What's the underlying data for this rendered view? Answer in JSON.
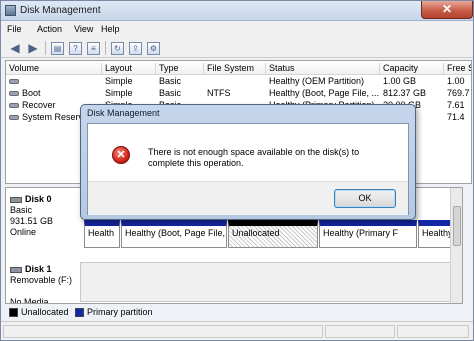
{
  "window": {
    "title": "Disk Management",
    "close_glyph": "✕"
  },
  "menu": [
    "File",
    "Action",
    "View",
    "Help"
  ],
  "toolbar": {
    "icons": [
      "back-arrow-icon",
      "forward-arrow-icon",
      "console-tree-icon",
      "help-icon",
      "properties-icon",
      "refresh-icon",
      "export-icon"
    ]
  },
  "volumes": {
    "columns": [
      "Volume",
      "Layout",
      "Type",
      "File System",
      "Status",
      "Capacity",
      "Free S"
    ],
    "rows": [
      {
        "volume": "",
        "layout": "Simple",
        "type": "Basic",
        "fs": "",
        "status": "Healthy (OEM Partition)",
        "capacity": "1.00 GB",
        "free": "1.00"
      },
      {
        "volume": "Boot",
        "layout": "Simple",
        "type": "Basic",
        "fs": "NTFS",
        "status": "Healthy (Boot, Page File, ...",
        "capacity": "812.37 GB",
        "free": "769.7"
      },
      {
        "volume": "Recover",
        "layout": "Simple",
        "type": "Basic",
        "fs": "",
        "status": "Healthy (Primary Partition)",
        "capacity": "20.00 GB",
        "free": "7.61"
      },
      {
        "volume": "System Reserved",
        "layout": "",
        "type": "",
        "fs": "",
        "status": "",
        "capacity": "",
        "free": "71.4"
      }
    ]
  },
  "disks": [
    {
      "name": "Disk 0",
      "type": "Basic",
      "size": "931.51 GB",
      "state": "Online",
      "partitions": [
        "Health",
        "Healthy (Boot, Page File, C",
        "Unallocated",
        "Healthy (Primary F",
        "Healthy (OE"
      ]
    },
    {
      "name": "Disk 1",
      "type": "Removable (F:)",
      "size": "",
      "state": "No Media",
      "partitions": []
    }
  ],
  "legend": [
    {
      "label": "Unallocated",
      "color": "#000000"
    },
    {
      "label": "Primary partition",
      "color": "#1427a6"
    }
  ],
  "dialog": {
    "title": "Disk Management",
    "message": "There is not enough space available on the disk(s) to complete this operation.",
    "ok_label": "OK",
    "icon": "error-icon"
  }
}
